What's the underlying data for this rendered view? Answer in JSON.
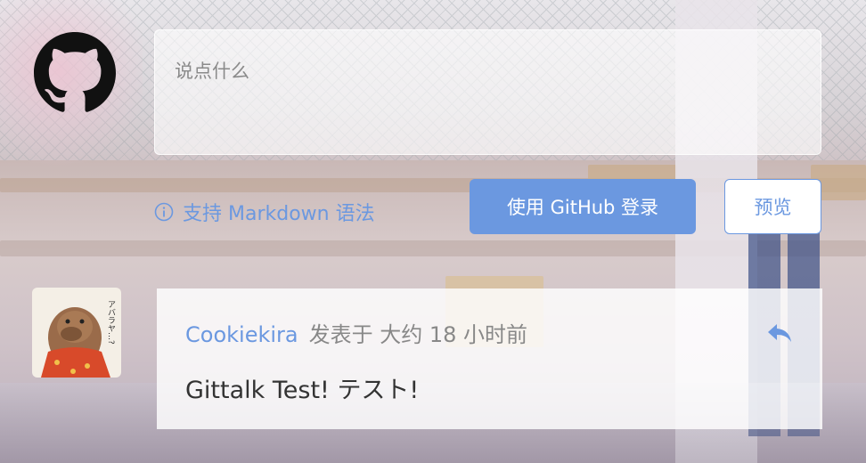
{
  "editor": {
    "placeholder": "说点什么"
  },
  "markdown_tip": {
    "label": "支持 Markdown 语法",
    "icon": "info-icon"
  },
  "buttons": {
    "login": "使用 GitHub 登录",
    "preview": "预览"
  },
  "comment": {
    "author": "Cookiekira",
    "meta": "发表于 大约 18 小时前",
    "body": "Gittalk Test!  テスト!",
    "avatar_text": "アバラヤ…?",
    "reply_icon": "reply-icon"
  },
  "colors": {
    "accent": "#6b98e0",
    "text": "#333333",
    "muted": "#888888"
  }
}
